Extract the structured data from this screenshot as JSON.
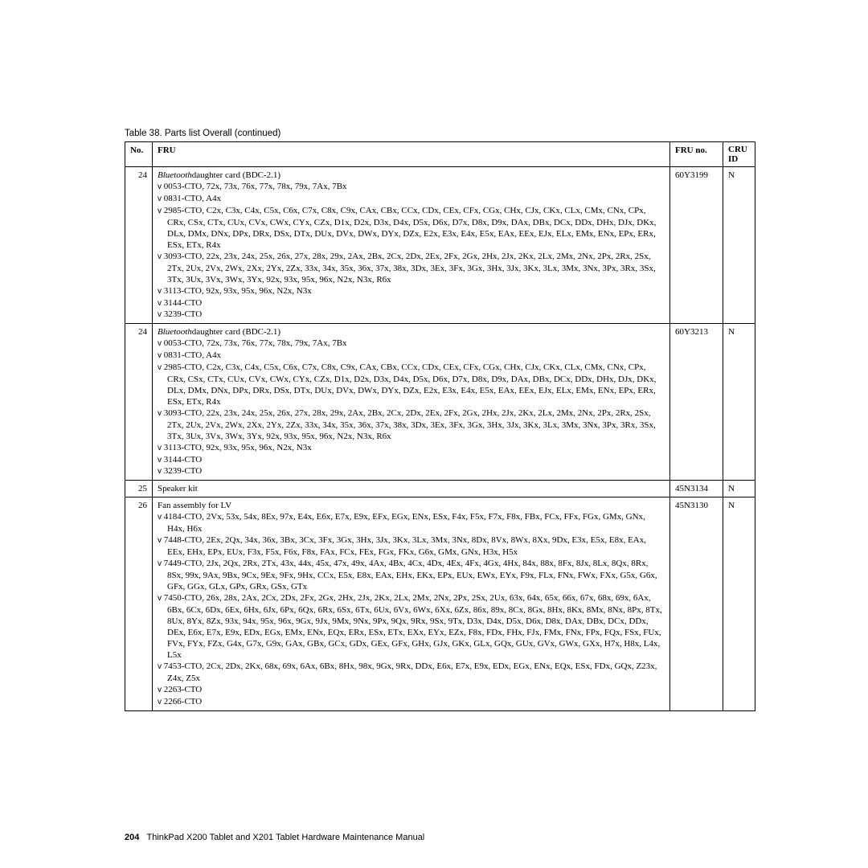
{
  "caption": "Table 38. Parts list Overall  (continued)",
  "headers": {
    "no": "No.",
    "fru": "FRU",
    "fruno": "FRU no.",
    "cru1": "CRU",
    "cru2": "ID"
  },
  "rows": [
    {
      "no": "24",
      "lead": "Bluetoothdaughter card (BDC-2.1)",
      "bullets": [
        "0053-CTO, 72x, 73x, 76x, 77x, 78x, 79x, 7Ax, 7Bx",
        "0831-CTO, A4x",
        "2985-CTO, C2x, C3x, C4x, C5x, C6x, C7x, C8x, C9x, CAx, CBx, CCx, CDx, CEx, CFx, CGx, CHx, CJx, CKx, CLx, CMx, CNx, CPx, CRx, CSx, CTx, CUx, CVx, CWx, CYx, CZx, D1x, D2x, D3x, D4x, D5x, D6x, D7x, D8x, D9x, DAx, DBx, DCx, DDx, DHx, DJx, DKx, DLx, DMx, DNx, DPx, DRx, DSx, DTx, DUx, DVx, DWx, DYx, DZx, E2x, E3x, E4x, E5x, EAx, EEx, EJx, ELx, EMx, ENx, EPx, ERx, ESx, ETx, R4x",
        "3093-CTO, 22x, 23x, 24x, 25x, 26x, 27x, 28x, 29x, 2Ax, 2Bx, 2Cx, 2Dx, 2Ex, 2Fx, 2Gx, 2Hx, 2Jx, 2Kx, 2Lx, 2Mx, 2Nx, 2Px, 2Rx, 2Sx, 2Tx, 2Ux, 2Vx, 2Wx, 2Xx, 2Yx, 2Zx, 33x, 34x, 35x, 36x, 37x, 38x, 3Dx, 3Ex, 3Fx, 3Gx, 3Hx, 3Jx, 3Kx, 3Lx, 3Mx, 3Nx, 3Px, 3Rx, 3Sx, 3Tx, 3Ux, 3Vx, 3Wx, 3Yx, 92x, 93x, 95x, 96x, N2x, N3x, R6x",
        "3113-CTO, 92x, 93x, 95x, 96x, N2x, N3x",
        "3144-CTO",
        "3239-CTO"
      ],
      "fruno": "60Y3199",
      "cru": "N"
    },
    {
      "no": "24",
      "lead": "Bluetoothdaughter card (BDC-2.1)",
      "bullets": [
        "0053-CTO, 72x, 73x, 76x, 77x, 78x, 79x, 7Ax, 7Bx",
        "0831-CTO, A4x",
        "2985-CTO, C2x, C3x, C4x, C5x, C6x, C7x, C8x, C9x, CAx, CBx, CCx, CDx, CEx, CFx, CGx, CHx, CJx, CKx, CLx, CMx, CNx, CPx, CRx, CSx, CTx, CUx, CVx, CWx, CYx, CZx, D1x, D2x, D3x, D4x, D5x, D6x, D7x, D8x, D9x, DAx, DBx, DCx, DDx, DHx, DJx, DKx, DLx, DMx, DNx, DPx, DRx, DSx, DTx, DUx, DVx, DWx, DYx, DZx, E2x, E3x, E4x, E5x, EAx, EEx, EJx, ELx, EMx, ENx, EPx, ERx, ESx, ETx, R4x",
        "3093-CTO, 22x, 23x, 24x, 25x, 26x, 27x, 28x, 29x, 2Ax, 2Bx, 2Cx, 2Dx, 2Ex, 2Fx, 2Gx, 2Hx, 2Jx, 2Kx, 2Lx, 2Mx, 2Nx, 2Px, 2Rx, 2Sx, 2Tx, 2Ux, 2Vx, 2Wx, 2Xx, 2Yx, 2Zx, 33x, 34x, 35x, 36x, 37x, 38x, 3Dx, 3Ex, 3Fx, 3Gx, 3Hx, 3Jx, 3Kx, 3Lx, 3Mx, 3Nx, 3Px, 3Rx, 3Sx, 3Tx, 3Ux, 3Vx, 3Wx, 3Yx, 92x, 93x, 95x, 96x, N2x, N3x, R6x",
        "3113-CTO, 92x, 93x, 95x, 96x, N2x, N3x",
        "3144-CTO",
        "3239-CTO"
      ],
      "fruno": "60Y3213",
      "cru": "N"
    },
    {
      "no": "25",
      "lead": "Speaker kit",
      "bullets": [],
      "fruno": "45N3134",
      "cru": "N"
    },
    {
      "no": "26",
      "lead": "Fan assembly for LV",
      "bullets": [
        "4184-CTO, 2Vx, 53x, 54x, 8Ex, 97x, E4x, E6x, E7x, E9x, EFx, EGx, ENx, ESx, F4x, F5x, F7x, F8x, FBx, FCx, FFx, FGx, GMx, GNx, H4x, H6x",
        "7448-CTO, 2Ex, 2Qx, 34x, 36x, 3Bx, 3Cx, 3Fx, 3Gx, 3Hx, 3Jx, 3Kx, 3Lx, 3Mx, 3Nx, 8Dx, 8Vx, 8Wx, 8Xx, 9Dx, E3x, E5x, E8x, EAx, EEx, EHx, EPx, EUx, F3x, F5x, F6x, F8x, FAx, FCx, FEx, FGx, FKx, G6x, GMx, GNx, H3x, H5x",
        "7449-CTO, 2Jx, 2Qx, 2Rx, 2Tx, 43x, 44x, 45x, 47x, 49x, 4Ax, 4Bx, 4Cx, 4Dx, 4Ex, 4Fx, 4Gx, 4Hx, 84x, 88x, 8Fx, 8Jx, 8Lx, 8Qx, 8Rx, 8Sx, 99x, 9Ax, 9Bx, 9Cx, 9Ex, 9Fx, 9Hx, CCx, E5x, E8x, EAx, EHx, EKx, EPx, EUx, EWx, EYx, F9x, FLx, FNx, FWx, FXx, G5x, G6x, GFx, GGx, GLx, GPx, GRx, GSx, GTx",
        "7450-CTO, 26x, 28x, 2Ax, 2Cx, 2Dx, 2Fx, 2Gx, 2Hx, 2Jx, 2Kx, 2Lx, 2Mx, 2Nx, 2Px, 2Sx, 2Ux, 63x, 64x, 65x, 66x, 67x, 68x, 69x, 6Ax, 6Bx, 6Cx, 6Dx, 6Ex, 6Hx, 6Jx, 6Px, 6Qx, 6Rx, 6Sx, 6Tx, 6Ux, 6Vx, 6Wx, 6Xx, 6Zx, 86x, 89x, 8Cx, 8Gx, 8Hx, 8Kx, 8Mx, 8Nx, 8Px, 8Tx, 8Ux, 8Yx, 8Zx, 93x, 94x, 95x, 96x, 9Gx, 9Jx, 9Mx, 9Nx, 9Px, 9Qx, 9Rx, 9Sx, 9Tx, D3x, D4x, D5x, D6x, D8x, DAx, DBx, DCx, DDx, DEx, E6x, E7x, E9x, EDx, EGx, EMx, ENx, EQx, ERx, ESx, ETx, EXx, EYx, EZx, F8x, FDx, FHx, FJx, FMx, FNx, FPx, FQx, FSx, FUx, FVx, FYx, FZx, G4x, G7x, G9x, GAx, GBx, GCx, GDx, GEx, GFx, GHx, GJx, GKx, GLx, GQx, GUx, GVx, GWx, GXx, H7x, H8x, L4x, L5x",
        "7453-CTO, 2Cx, 2Dx, 2Kx, 68x, 69x, 6Ax, 6Bx, 8Hx, 98x, 9Gx, 9Rx, DDx, E6x, E7x, E9x, EDx, EGx, ENx, EQx, ESx, FDx, GQx, Z23x, Z4x, Z5x",
        "2263-CTO",
        "2266-CTO"
      ],
      "fruno": "45N3130",
      "cru": "N"
    }
  ],
  "footer": {
    "page": "204",
    "title": "ThinkPad X200 Tablet and X201 Tablet Hardware Maintenance Manual"
  }
}
